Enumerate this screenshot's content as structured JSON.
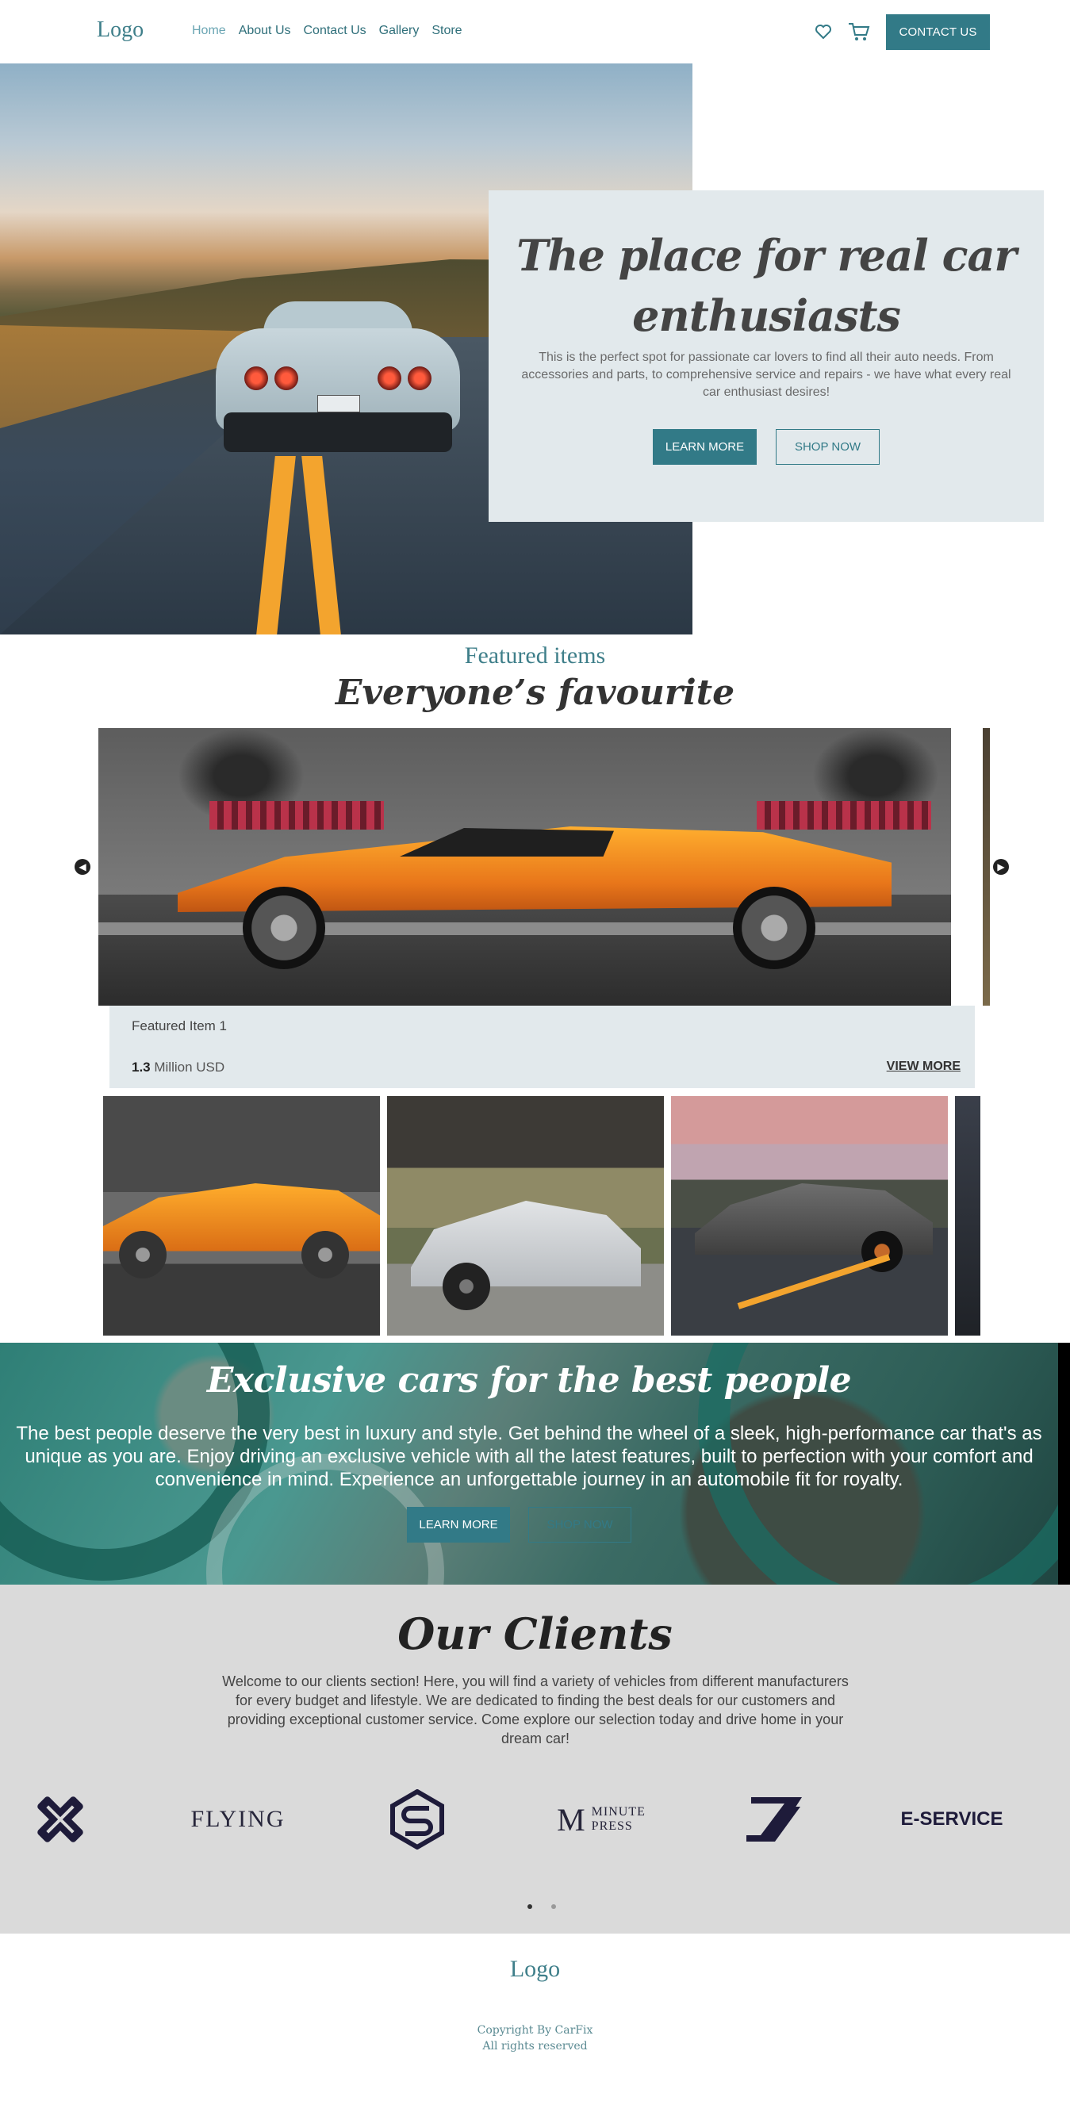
{
  "header": {
    "logo": "Logo",
    "nav": [
      "Home",
      "About Us",
      "Contact Us",
      "Gallery",
      "Store"
    ],
    "contact_button": "CONTACT US",
    "icons": [
      "heart-icon",
      "cart-icon"
    ]
  },
  "hero": {
    "title": "The place for real car enthusiasts",
    "text": "This is the perfect spot for passionate car lovers to find all their auto needs. From accessories and parts, to comprehensive service and repairs - we have what every real car enthusiast desires!",
    "primary_button": "LEARN MORE",
    "secondary_button": "SHOP NOW"
  },
  "featured": {
    "kicker": "Featured items",
    "title": "Everyone’s favourite",
    "item_name": "Featured Item 1",
    "price_value": "1.3",
    "price_unit": " Million USD",
    "view_more": "VIEW MORE"
  },
  "exclusive": {
    "title": "Exclusive cars for the best people",
    "text": "The best people deserve the very best in luxury and style. Get behind the wheel of a sleek, high-performance car that's as unique as you are. Enjoy driving an exclusive vehicle with all the latest features, built to perfection with your comfort and convenience in mind. Experience an unforgettable journey in an automobile fit for royalty.",
    "primary_button": "LEARN MORE",
    "secondary_button": "SHOP NOW"
  },
  "clients": {
    "title": "Our Clients",
    "text": "Welcome to our clients section! Here, you will find a variety of vehicles from different manufacturers for every budget and lifestyle. We are dedicated to finding the best deals for our customers and providing exceptional customer service. Come explore our selection today and drive home in your dream car!",
    "logos": {
      "flying": "FLYING",
      "minute_m": "M",
      "minute_word1": "MINUTE",
      "minute_word2": "PRESS",
      "eservice": "E-SERVICE"
    }
  },
  "footer": {
    "logo": "Logo",
    "copyright": "Copyright By CarFix",
    "rights": "All rights reserved"
  },
  "colors": {
    "accent": "#327a87",
    "panel": "#e2e9ec",
    "clients_bg": "#dadada"
  }
}
